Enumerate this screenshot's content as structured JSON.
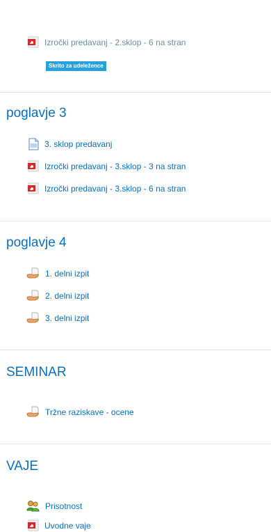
{
  "top": {
    "item": "Izročki predavanj - 2.sklop - 6 na stran",
    "badge": "Skrito za udeležence"
  },
  "sections": [
    {
      "title": "poglavje 3",
      "items": [
        {
          "label": "3. sklop predavanj",
          "icon": "document-icon"
        },
        {
          "label": "Izročki predavanj - 3.sklop - 3 na stran",
          "icon": "pdf-icon"
        },
        {
          "label": "Izročki predavanj - 3.sklop - 6 na stran",
          "icon": "pdf-icon"
        }
      ]
    },
    {
      "title": "poglavje 4",
      "items": [
        {
          "label": "1. delni izpit",
          "icon": "assignment-icon"
        },
        {
          "label": "2. delni izpit",
          "icon": "assignment-icon"
        },
        {
          "label": "3. delni izpit",
          "icon": "assignment-icon"
        }
      ]
    },
    {
      "title": "SEMINAR",
      "items": [
        {
          "label": "Tržne raziskave - ocene",
          "icon": "assignment-icon"
        }
      ]
    },
    {
      "title": "VAJE",
      "items": [
        {
          "label": "Prisotnost",
          "icon": "attendance-icon"
        },
        {
          "label": "Uvodne vaje",
          "icon": "pdf-icon"
        }
      ]
    }
  ],
  "colors": {
    "link": "#0a6ebd",
    "dimmed_link": "#6a8eaa",
    "badge_bg": "#28a0dc",
    "divider": "#e2e2e2",
    "pdf_red": "#d42a2a"
  }
}
